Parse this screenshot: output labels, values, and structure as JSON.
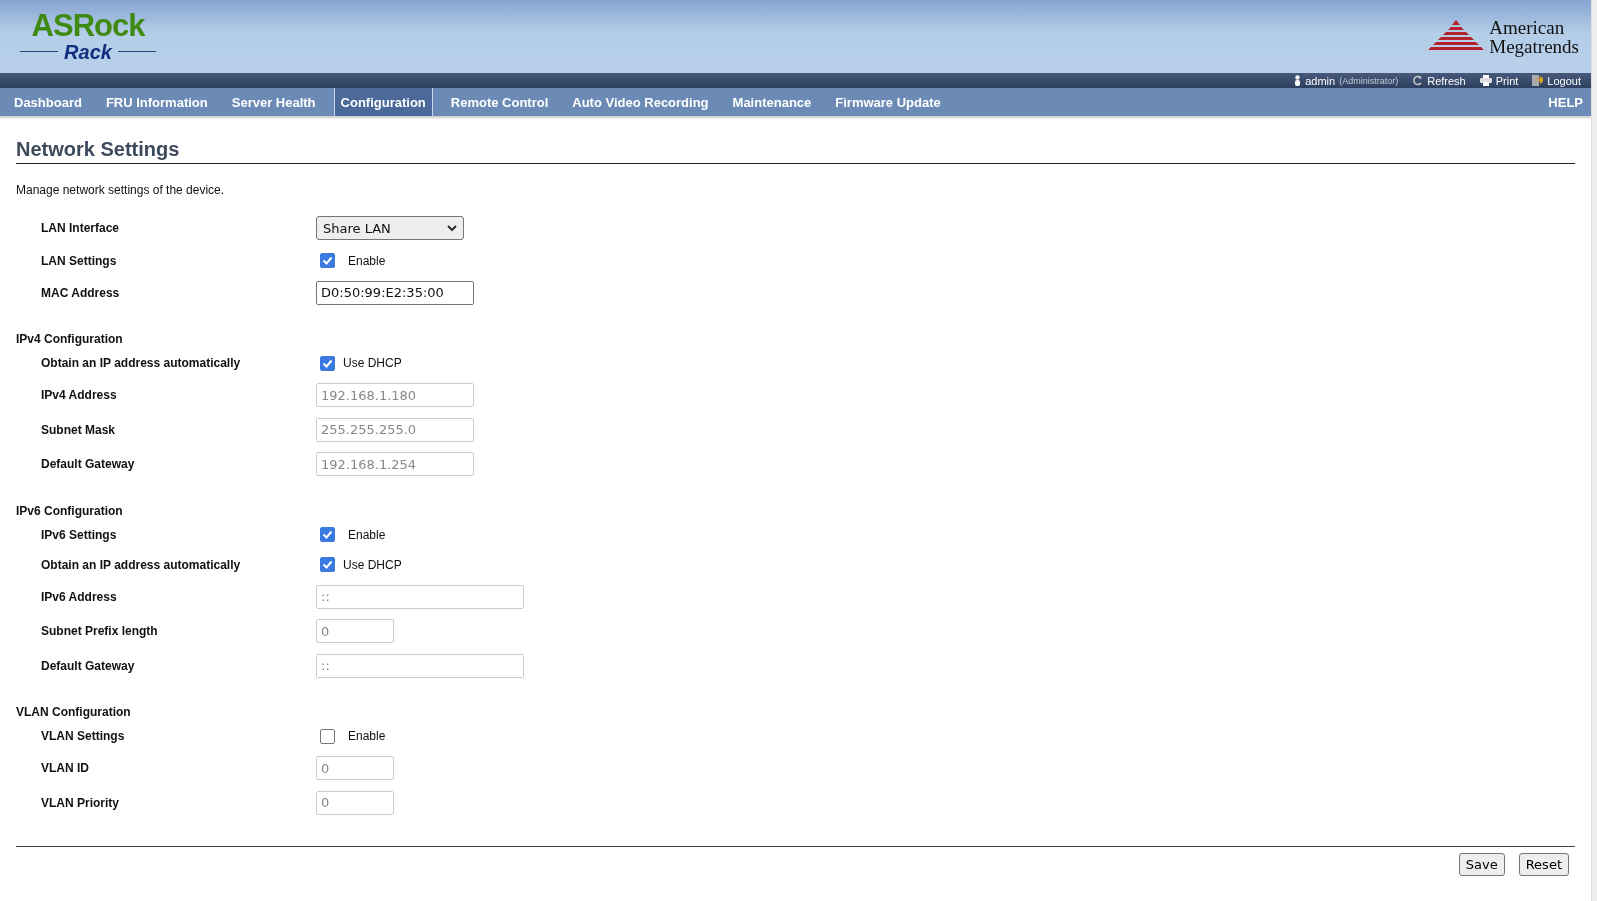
{
  "header": {
    "logo_top": "ASRock",
    "logo_bottom": "Rack",
    "vendor_line1": "American",
    "vendor_line2": "Megatrends"
  },
  "user_bar": {
    "user": "admin",
    "role": "(Administrator)",
    "links": [
      "Refresh",
      "Print",
      "Logout"
    ]
  },
  "nav": {
    "tabs": [
      {
        "label": "Dashboard",
        "selected": false
      },
      {
        "label": "FRU Information",
        "selected": false
      },
      {
        "label": "Server Health",
        "selected": false
      },
      {
        "label": "Configuration",
        "selected": true
      },
      {
        "label": "Remote Control",
        "selected": false
      },
      {
        "label": "Auto Video Recording",
        "selected": false
      },
      {
        "label": "Maintenance",
        "selected": false
      },
      {
        "label": "Firmware Update",
        "selected": false
      }
    ],
    "help": "HELP"
  },
  "page": {
    "title": "Network Settings",
    "description": "Manage network settings of the device."
  },
  "sections": [
    {
      "rows": [
        {
          "label": "LAN Interface",
          "kind": "select",
          "value": "Share LAN"
        },
        {
          "label": "LAN Settings",
          "kind": "checkbox",
          "checked": true,
          "text": "Enable"
        },
        {
          "label": "MAC Address",
          "kind": "text",
          "value": "D0:50:99:E2:35:00",
          "disabled": false
        }
      ]
    },
    {
      "heading": "IPv4 Configuration",
      "rows": [
        {
          "label": "Obtain an IP address automatically",
          "kind": "checkbox",
          "checked": true,
          "text": "Use DHCP"
        },
        {
          "label": "IPv4 Address",
          "kind": "text",
          "value": "192.168.1.180",
          "disabled": true
        },
        {
          "label": "Subnet Mask",
          "kind": "text",
          "value": "255.255.255.0",
          "disabled": true
        },
        {
          "label": "Default Gateway",
          "kind": "text",
          "value": "192.168.1.254",
          "disabled": true
        }
      ]
    },
    {
      "heading": "IPv6 Configuration",
      "rows": [
        {
          "label": "IPv6 Settings",
          "kind": "checkbox",
          "checked": true,
          "text": "Enable"
        },
        {
          "label": "Obtain an IP address automatically",
          "kind": "checkbox",
          "checked": true,
          "text": "Use DHCP"
        },
        {
          "label": "IPv6 Address",
          "kind": "wide",
          "value": "::",
          "disabled": true
        },
        {
          "label": "Subnet Prefix length",
          "kind": "short",
          "value": "0",
          "disabled": true
        },
        {
          "label": "Default Gateway",
          "kind": "wide",
          "value": "::",
          "disabled": true
        }
      ]
    },
    {
      "heading": "VLAN Configuration",
      "rows": [
        {
          "label": "VLAN Settings",
          "kind": "checkbox",
          "checked": false,
          "text": "Enable"
        },
        {
          "label": "VLAN ID",
          "kind": "short",
          "value": "0",
          "disabled": true
        },
        {
          "label": "VLAN Priority",
          "kind": "short",
          "value": "0",
          "disabled": true
        }
      ]
    }
  ],
  "buttons": [
    "Save",
    "Reset"
  ]
}
